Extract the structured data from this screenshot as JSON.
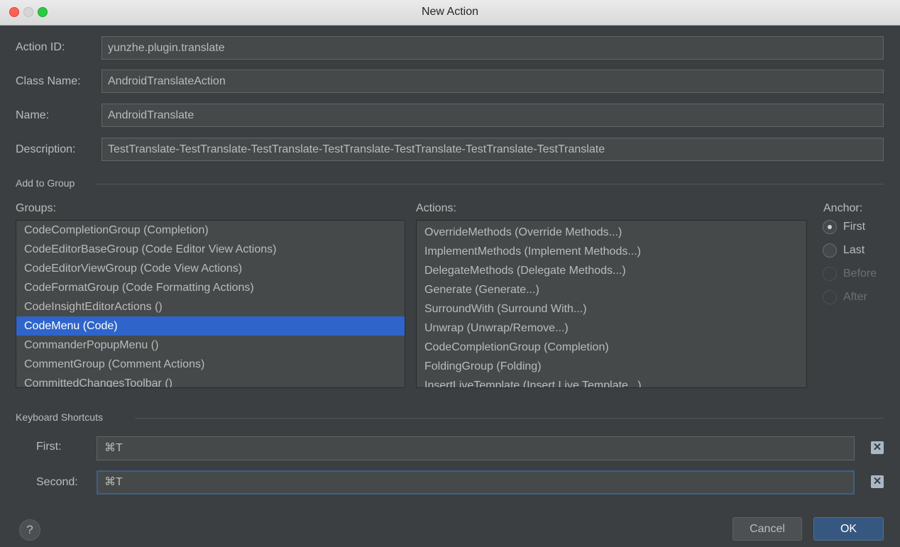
{
  "window": {
    "title": "New Action"
  },
  "fields": {
    "action_id": {
      "label": "Action ID:",
      "value": "yunzhe.plugin.translate"
    },
    "class_name": {
      "label": "Class Name:",
      "value": "AndroidTranslateAction"
    },
    "name": {
      "label": "Name:",
      "value": "AndroidTranslate"
    },
    "description": {
      "label": "Description:",
      "value": "TestTranslate-TestTranslate-TestTranslate-TestTranslate-TestTranslate-TestTranslate-TestTranslate"
    }
  },
  "add_to_group": {
    "section_title": "Add to Group",
    "groups_label": "Groups:",
    "groups": [
      "CodeCompletionGroup (Completion)",
      "CodeEditorBaseGroup (Code Editor View Actions)",
      "CodeEditorViewGroup (Code View Actions)",
      "CodeFormatGroup (Code Formatting Actions)",
      "CodeInsightEditorActions ()",
      "CodeMenu (Code)",
      "CommanderPopupMenu ()",
      "CommentGroup (Comment Actions)",
      "CommittedChangesToolbar ()"
    ],
    "selected_group_index": 5,
    "actions_label": "Actions:",
    "actions": [
      "OverrideMethods (Override Methods...)",
      "ImplementMethods (Implement Methods...)",
      "DelegateMethods (Delegate Methods...)",
      "Generate (Generate...)",
      "SurroundWith (Surround With...)",
      "Unwrap (Unwrap/Remove...)",
      "CodeCompletionGroup (Completion)",
      "FoldingGroup (Folding)",
      "InsertLiveTemplate (Insert Live Template...)"
    ],
    "anchor_label": "Anchor:",
    "anchors": [
      {
        "label": "First",
        "checked": true,
        "enabled": true
      },
      {
        "label": "Last",
        "checked": false,
        "enabled": true
      },
      {
        "label": "Before",
        "checked": false,
        "enabled": false
      },
      {
        "label": "After",
        "checked": false,
        "enabled": false
      }
    ]
  },
  "keyboard_shortcuts": {
    "section_title": "Keyboard Shortcuts",
    "first": {
      "label": "First:",
      "value": "⌘T"
    },
    "second": {
      "label": "Second:",
      "value": "⌘T"
    }
  },
  "buttons": {
    "help": "?",
    "cancel": "Cancel",
    "ok": "OK"
  },
  "colors": {
    "background": "#3c3f41",
    "selection": "#2f65ca",
    "ok_button": "#365880"
  }
}
